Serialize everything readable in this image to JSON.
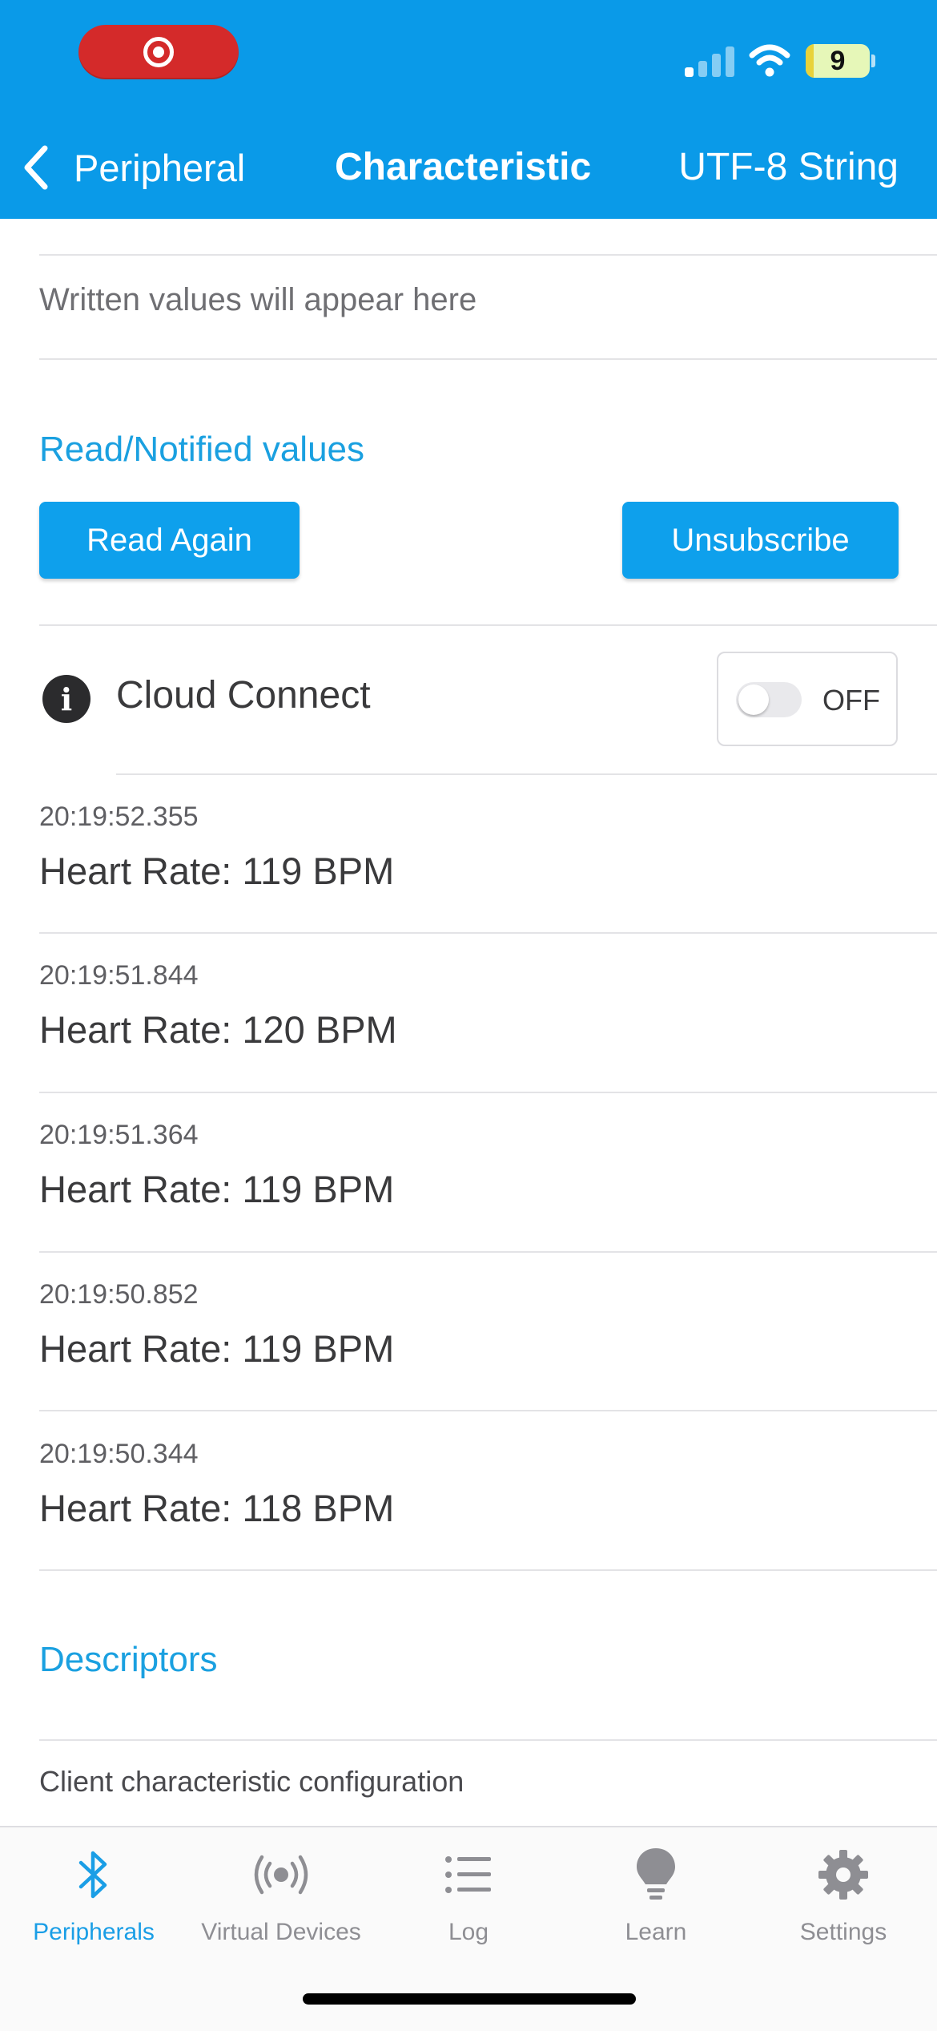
{
  "status_bar": {
    "battery": "9"
  },
  "nav": {
    "back_label": "Peripheral",
    "title": "Characteristic",
    "format": "UTF-8 String"
  },
  "written": {
    "placeholder": "Written values will appear here"
  },
  "read_section": {
    "title": "Read/Notified values",
    "read_again": "Read Again",
    "unsubscribe": "Unsubscribe"
  },
  "cloud": {
    "label": "Cloud Connect",
    "toggle_state": "OFF"
  },
  "readings": [
    {
      "time": "20:19:52.355",
      "value": "Heart Rate: 119 BPM"
    },
    {
      "time": "20:19:51.844",
      "value": "Heart Rate: 120 BPM"
    },
    {
      "time": "20:19:51.364",
      "value": "Heart Rate: 119 BPM"
    },
    {
      "time": "20:19:50.852",
      "value": "Heart Rate: 119 BPM"
    },
    {
      "time": "20:19:50.344",
      "value": "Heart Rate: 118 BPM"
    }
  ],
  "descriptors": {
    "title": "Descriptors",
    "item": "Client characteristic configuration"
  },
  "tabs": [
    {
      "label": "Peripherals",
      "icon": "bluetooth-icon"
    },
    {
      "label": "Virtual Devices",
      "icon": "broadcast-icon"
    },
    {
      "label": "Log",
      "icon": "list-icon"
    },
    {
      "label": "Learn",
      "icon": "lightbulb-icon"
    },
    {
      "label": "Settings",
      "icon": "gear-icon"
    }
  ],
  "colors": {
    "accent": "#0a9ae8",
    "recording": "#d42a2a"
  }
}
